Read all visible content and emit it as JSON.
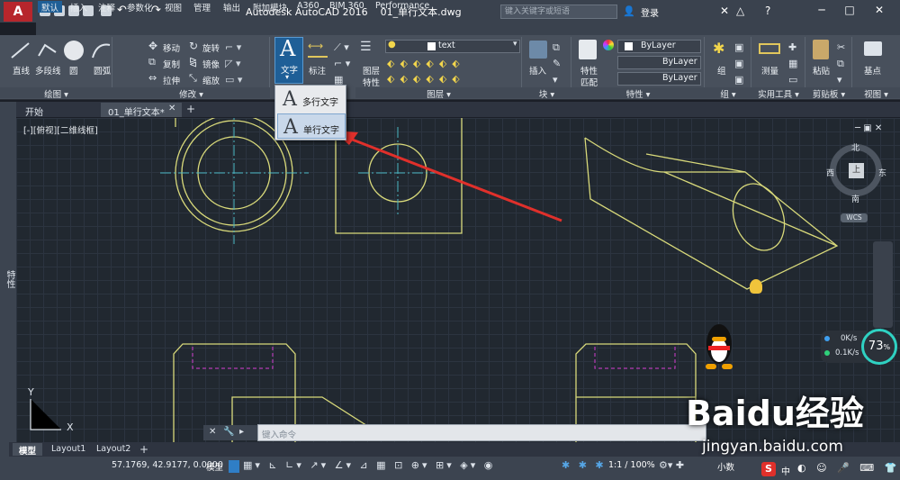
{
  "window": {
    "app_title": "Autodesk AutoCAD 2016",
    "file_name": "01_单行文本.dwg",
    "search_placeholder": "键入关键字或短语",
    "login_label": "登录"
  },
  "ribbon_tabs": [
    "默认",
    "插入",
    "注释",
    "参数化",
    "视图",
    "管理",
    "输出",
    "附加模块",
    "A360",
    "BIM 360",
    "Performance"
  ],
  "ribbon": {
    "draw": {
      "line": "直线",
      "polyline": "多段线",
      "circle": "圆",
      "arc": "圆弧",
      "panel_label": "绘图"
    },
    "modify": {
      "move": "移动",
      "rotate": "旋转",
      "copy": "复制",
      "mirror": "镜像",
      "stretch": "拉伸",
      "scale": "缩放",
      "panel_label": "修改"
    },
    "annotation": {
      "text": "文字",
      "dimension": "标注"
    },
    "layers": {
      "current_layer": "text",
      "layer_props": "图层",
      "layer_props2": "特性",
      "panel_label": "图层"
    },
    "block": {
      "insert": "插入",
      "panel_label": "块"
    },
    "properties": {
      "match": "特性",
      "match2": "匹配",
      "color": "ByLayer",
      "linetype": "ByLayer",
      "lineweight": "ByLayer",
      "panel_label": "特性"
    },
    "groups": {
      "group": "组",
      "panel_label": "组"
    },
    "utilities": {
      "measure": "测量",
      "panel_label": "实用工具"
    },
    "clipboard": {
      "paste": "粘贴",
      "panel_label": "剪贴板"
    },
    "view": {
      "base": "基点",
      "panel_label": "视图"
    }
  },
  "text_dropdown": {
    "multiline": "多行文字",
    "single_line": "单行文字"
  },
  "doc_tabs": [
    "开始",
    "01_单行文本*"
  ],
  "viewport": {
    "label": "[-][俯视][二维线框]",
    "compass": {
      "n": "北",
      "s": "南",
      "e": "东",
      "w": "西",
      "top": "上"
    },
    "wcs": "WCS"
  },
  "side_panel_label": "特性",
  "command_line": {
    "placeholder": "键入命令"
  },
  "layout_tabs": [
    "模型",
    "Layout1",
    "Layout2"
  ],
  "status": {
    "coordinates": "57.1769, 42.9177, 0.0000",
    "model": "模型",
    "scale": "1:1 / 100%",
    "units": "小数"
  },
  "overlay": {
    "net_up": "0K/s",
    "net_down": "0.1K/s",
    "cpu_percent": "73",
    "watermark": "Baidu经验",
    "watermark_url": "jingyan.baidu.com",
    "ime": "中"
  },
  "colors": {
    "accent_blue": "#1f5f97",
    "drawing_yellow": "#d8d97a",
    "center_cyan": "#4ab7c4",
    "hidden_magenta": "#b43bb4",
    "arrow_red": "#e0302b"
  }
}
